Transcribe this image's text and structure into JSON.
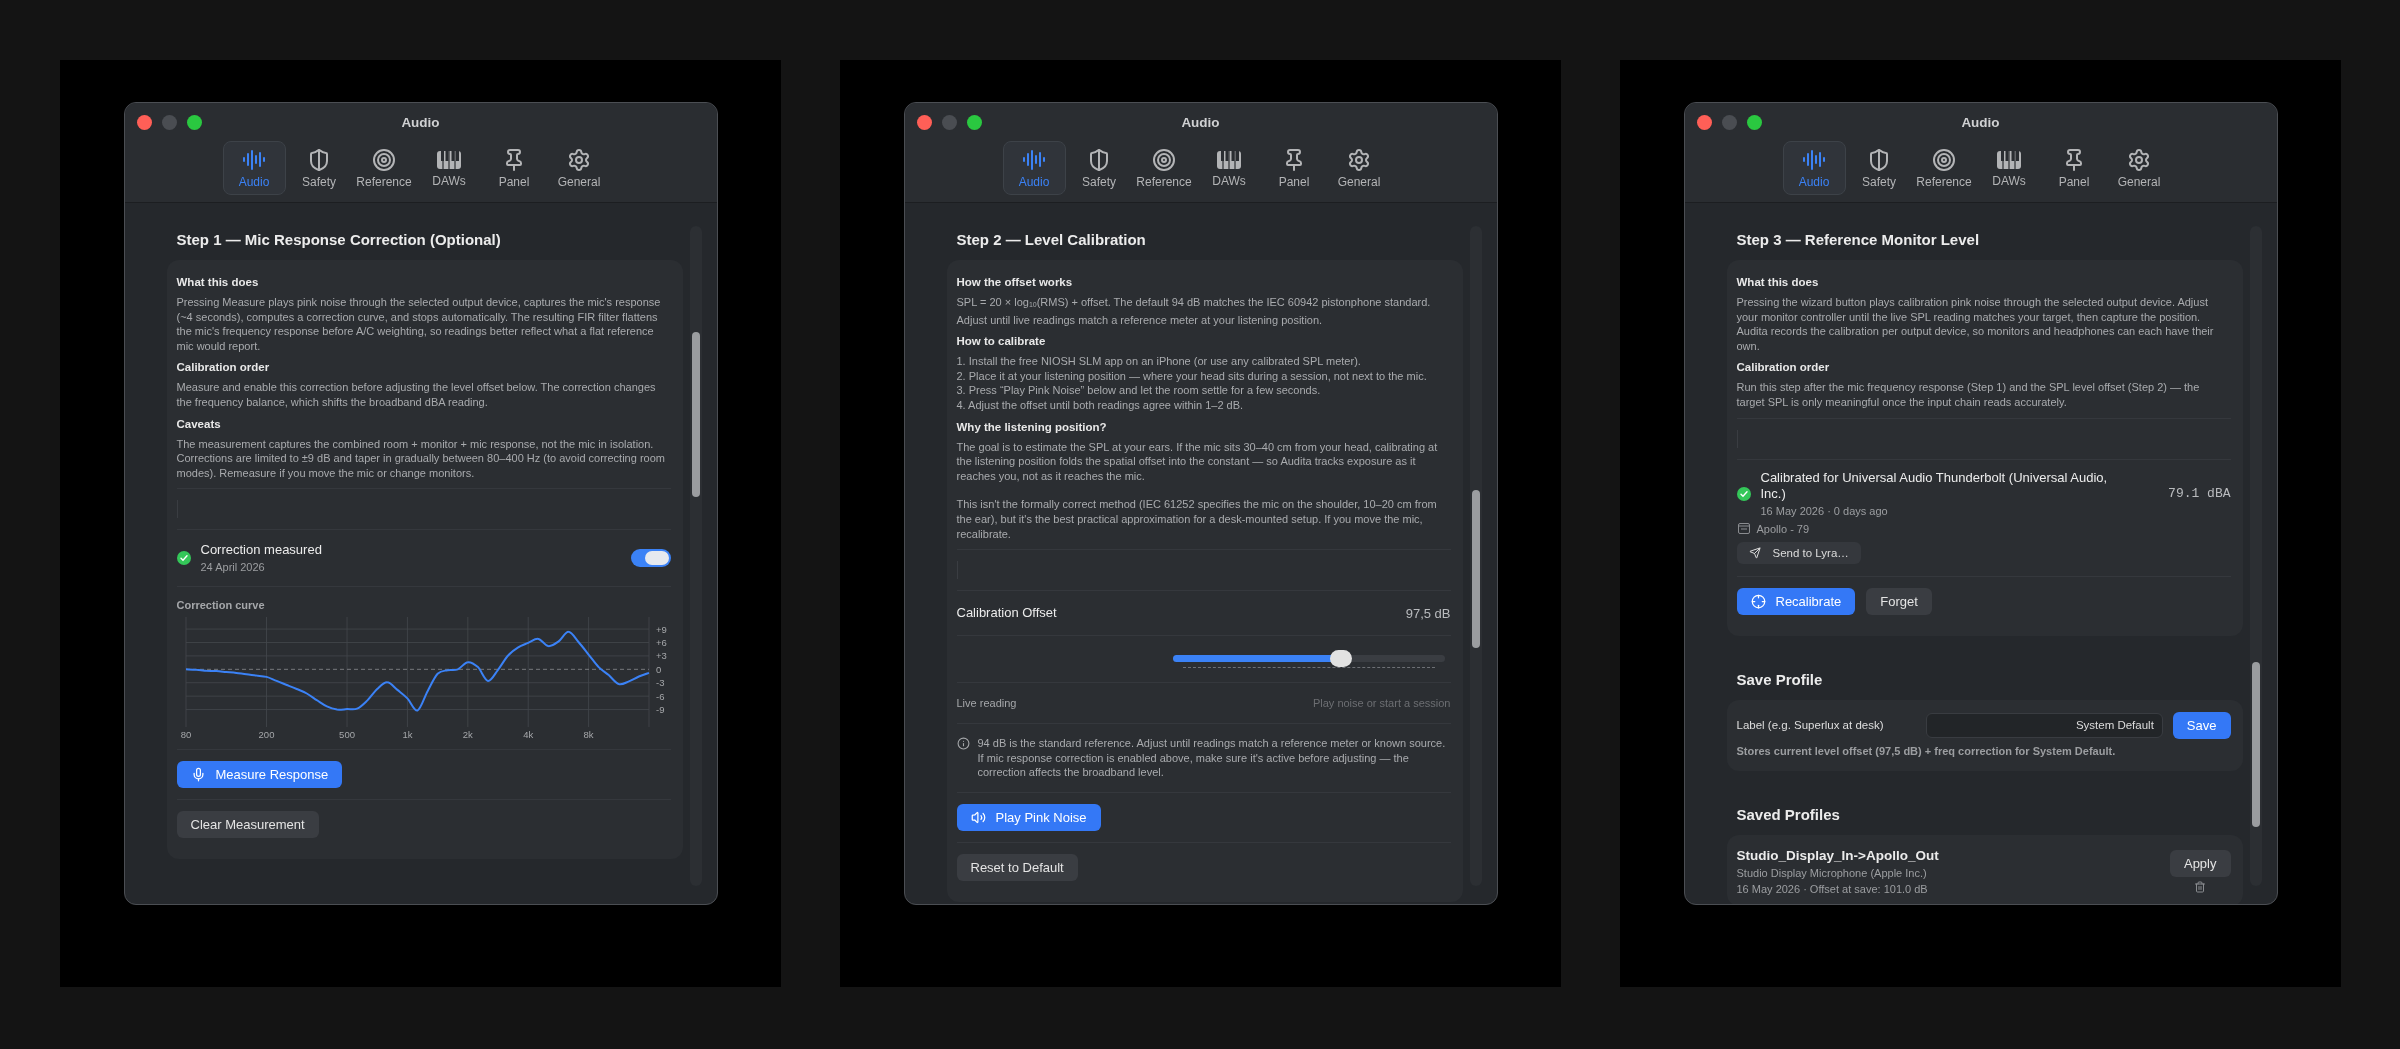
{
  "windows": [
    {
      "kind": "mic_response",
      "title": "Audio",
      "tabs": [
        {
          "label": "Audio",
          "selected": true
        },
        {
          "label": "Safety",
          "selected": false
        },
        {
          "label": "Reference",
          "selected": false
        },
        {
          "label": "DAWs",
          "selected": false
        },
        {
          "label": "Panel",
          "selected": false
        },
        {
          "label": "General",
          "selected": false
        }
      ],
      "step_title": "Step 1 — Mic Response Correction (Optional)",
      "sections": [
        {
          "heading": "What this does",
          "kind": "text",
          "paragraphs": [
            "Pressing Measure plays pink noise through the selected output device, captures the mic's response (~4 seconds), computes a correction curve, and stops automatically. The resulting FIR filter flattens the mic's frequency response before A/C weighting, so readings better reflect what a flat reference mic would report."
          ]
        },
        {
          "heading": "Calibration order",
          "kind": "text",
          "paragraphs": [
            "Measure and enable this correction before adjusting the level offset below. The correction changes the frequency balance, which shifts the broadband dBA reading."
          ]
        },
        {
          "heading": "Caveats",
          "kind": "text",
          "paragraphs": [
            "The measurement captures the combined room + monitor + mic response, not the mic in isolation. Corrections are limited to ±9 dB and taper in gradually between 80–400 Hz (to avoid correcting room modes). Remeasure if you move the mic or change monitors."
          ]
        }
      ],
      "status": {
        "title": "Correction measured",
        "date": "24 April 2026",
        "on": true
      },
      "chart_data": {
        "type": "line",
        "title": "Correction curve",
        "categories": [
          "80",
          null,
          null,
          null,
          null,
          null,
          null,
          null,
          "200",
          null,
          null,
          null,
          null,
          null,
          null,
          null,
          "500",
          null,
          null,
          null,
          null,
          null,
          "1k",
          null,
          null,
          null,
          null,
          null,
          "2k",
          null,
          null,
          null,
          null,
          null,
          "4k",
          null,
          null,
          null,
          null,
          null,
          "8k",
          null,
          null,
          null,
          null,
          null,
          null
        ],
        "series": [
          {
            "color": "#3b82f6",
            "values": [
              0,
              -0.1,
              -0.3,
              -0.4,
              -0.6,
              -0.8,
              -1.1,
              -1.4,
              -1.7,
              -2.6,
              -3.5,
              -4.4,
              -5.4,
              -6.9,
              -8.3,
              -9,
              -8.9,
              -8.8,
              -7,
              -4.4,
              -2.9,
              -4.6,
              -6.5,
              -9.2,
              -4.9,
              -1,
              -0.2,
              0,
              1.6,
              0.5,
              -2.6,
              -0.1,
              3.1,
              4.9,
              5.9,
              6.8,
              5.2,
              6.2,
              8.4,
              6.1,
              3.3,
              0.5,
              -1.3,
              -3.3,
              -2.7,
              -1.6,
              -0.8
            ]
          }
        ],
        "ylim": [
          -12.9,
          11.7
        ],
        "grid": true,
        "ref_lines": [
          {
            "axis": "y",
            "value": 0
          }
        ],
        "yticks": [
          {
            "value": 9,
            "label": "+9"
          },
          {
            "value": 6,
            "label": "+6"
          },
          {
            "value": 3,
            "label": "+3"
          },
          {
            "value": 0,
            "label": "0"
          },
          {
            "value": -3,
            "label": "-3"
          },
          {
            "value": -6,
            "label": "-6"
          },
          {
            "value": -9,
            "label": "-9"
          }
        ]
      },
      "buttons": [
        {
          "label": "Measure Response",
          "kind": "primary"
        },
        {
          "label": "Clear Measurement",
          "kind": "secondary"
        }
      ]
    },
    {
      "kind": "level_calibration",
      "title": "Audio",
      "tabs": [
        {
          "label": "Audio",
          "selected": true
        },
        {
          "label": "Safety",
          "selected": false
        },
        {
          "label": "Reference",
          "selected": false
        },
        {
          "label": "DAWs",
          "selected": false
        },
        {
          "label": "Panel",
          "selected": false
        },
        {
          "label": "General",
          "selected": false
        }
      ],
      "step_title": "Step 2 — Level Calibration",
      "sections": [
        {
          "heading": "How the offset works",
          "kind": "text",
          "paragraphs": [
            "SPL = 20 × log$_{10}$(RMS) + offset. The default 94 dB matches the IEC 60942 pistonphone standard. Adjust until live readings match a reference meter at your listening position."
          ]
        },
        {
          "heading": "How to calibrate",
          "kind": "steps",
          "paragraphs": [
            "1. Install the free NIOSH SLM app on an iPhone (or use any calibrated SPL meter).",
            "2. Place it at your listening position — where your head sits during a session, not next to the mic.",
            "3. Press “Play Pink Noise” below and let the room settle for a few seconds.",
            "4. Adjust the offset until both readings agree within 1–2 dB."
          ]
        },
        {
          "heading": "Why the listening position?",
          "kind": "text",
          "paragraphs": [
            "The goal is to estimate the SPL at your ears. If the mic sits 30–40 cm from your head, calibrating at the listening position folds the spatial offset into the constant — so Audita tracks exposure as it reaches you, not as it reaches the mic.",
            "This isn't the formally correct method (IEC 61252 specifies the mic on the shoulder, 10–20 cm from the ear), but it's the best practical approximation for a desk-mounted setup. If you move the mic, recalibrate."
          ]
        }
      ],
      "offset": {
        "label": "Calibration Offset",
        "reading": "97,5 dB",
        "level": 0.62
      },
      "live": {
        "label": "Live reading",
        "value": "Play noise or start a session"
      },
      "note": "94 dB is the standard reference. Adjust until readings match a reference meter or known source. If mic response correction is enabled above, make sure it's active before adjusting — the correction affects the broadband level.",
      "buttons": [
        {
          "label": "Play Pink Noise",
          "kind": "primary"
        },
        {
          "label": "Reset to Default",
          "kind": "secondary"
        }
      ]
    },
    {
      "kind": "reference_monitor",
      "title": "Audio",
      "tabs": [
        {
          "label": "Audio",
          "selected": true
        },
        {
          "label": "Safety",
          "selected": false
        },
        {
          "label": "Reference",
          "selected": false
        },
        {
          "label": "DAWs",
          "selected": false
        },
        {
          "label": "Panel",
          "selected": false
        },
        {
          "label": "General",
          "selected": false
        }
      ],
      "step_title": "Step 3 — Reference Monitor Level",
      "sections": [
        {
          "heading": "What this does",
          "kind": "text",
          "paragraphs": [
            "Pressing the wizard button plays calibration pink noise through the selected output device. Adjust your monitor controller until the live SPL reading matches your target, then capture the position. Audita records the calibration per output device, so monitors and headphones can each have their own."
          ]
        },
        {
          "heading": "Calibration order",
          "kind": "text",
          "paragraphs": [
            "Run this step after the mic frequency response (Step 1) and the SPL level offset (Step 2) — the target SPL is only meaningful once the input chain reads accurately."
          ]
        }
      ],
      "calibration": {
        "title": "Calibrated for Universal Audio Thunderbolt (Universal Audio, Inc.)",
        "date": "16 May 2026 · 0 days ago",
        "reading": "79.1 dBA",
        "preset": "Apollo - 79",
        "send_label": "Send to Lyra…"
      },
      "buttons": [
        {
          "label": "Recalibrate",
          "kind": "primary"
        },
        {
          "label": "Forget",
          "kind": "secondary"
        }
      ],
      "save_profile": {
        "heading": "Save Profile",
        "label": "Label (e.g. Superlux at desk)",
        "value": "System Default",
        "button": "Save",
        "note": "Stores current level offset (97,5 dB) + freq correction for System Default."
      },
      "saved_profiles": {
        "heading": "Saved Profiles",
        "items": [
          {
            "name": "Studio_Display_In->Apollo_Out",
            "device": "Studio Display Microphone (Apple Inc.)",
            "meta": "16 May 2026  ·  Offset at save: 101.0 dB",
            "button": "Apply"
          }
        ]
      }
    }
  ]
}
